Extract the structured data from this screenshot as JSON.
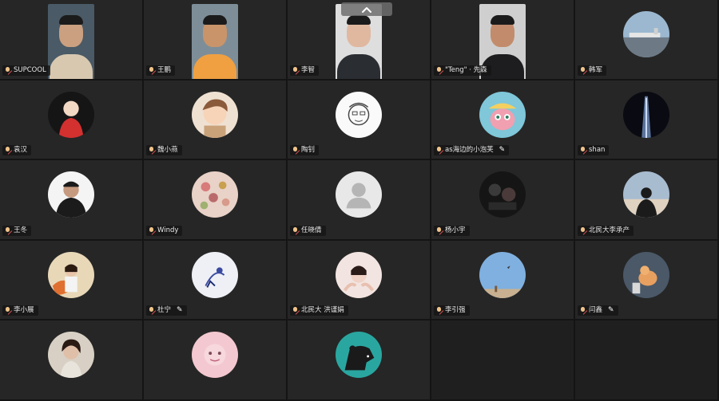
{
  "collapse_control": {
    "icon": "chevron-up-icon"
  },
  "participants": [
    {
      "name": "SUPCOOL",
      "kind": "video",
      "bg": "#4a5a66",
      "shirt": "#d8c8b0",
      "skin": "#caa080"
    },
    {
      "name": "王鹏",
      "kind": "video",
      "bg": "#7e8e99",
      "shirt": "#f0a040",
      "skin": "#c9946a"
    },
    {
      "name": "李智",
      "kind": "video",
      "bg": "#dedede",
      "shirt": "#2a2e33",
      "skin": "#e0b8a0"
    },
    {
      "name": "\"Teng\" · 先森",
      "kind": "video",
      "bg": "#cfcfcf",
      "shirt": "#1d1d1f",
      "skin": "#c28c6c"
    },
    {
      "name": "韩军",
      "kind": "avatar",
      "icon": "airport-photo-icon",
      "edit": false
    },
    {
      "name": "袁汉",
      "kind": "avatar",
      "icon": "red-shirt-figure-icon",
      "edit": false
    },
    {
      "name": "魏小燕",
      "kind": "avatar",
      "icon": "anime-boy-icon",
      "edit": false
    },
    {
      "name": "陶钊",
      "kind": "avatar",
      "icon": "sketch-face-icon",
      "edit": false
    },
    {
      "name": "as海边的小泡芙",
      "kind": "avatar",
      "icon": "cartoon-girl-icon",
      "edit": true
    },
    {
      "name": "shan",
      "kind": "avatar",
      "icon": "light-beam-icon",
      "edit": false
    },
    {
      "name": "王冬",
      "kind": "avatar",
      "icon": "man-black-jacket-icon",
      "edit": false
    },
    {
      "name": "Windy",
      "kind": "avatar",
      "icon": "flower-pattern-icon",
      "edit": false
    },
    {
      "name": "任晓倩",
      "kind": "avatar",
      "icon": "default-user-icon",
      "edit": false
    },
    {
      "name": "杨小宇",
      "kind": "avatar",
      "icon": "dark-photo-icon",
      "edit": false
    },
    {
      "name": "北民大李承产",
      "kind": "avatar",
      "icon": "sunset-silhouette-icon",
      "edit": false
    },
    {
      "name": "李小展",
      "kind": "avatar",
      "icon": "autumn-girl-icon",
      "edit": false
    },
    {
      "name": "杜宁",
      "kind": "avatar",
      "icon": "blue-sketch-icon",
      "edit": true
    },
    {
      "name": "北民大 洪谨娟",
      "kind": "avatar",
      "icon": "girl-hands-icon",
      "edit": false
    },
    {
      "name": "李引强",
      "kind": "avatar",
      "icon": "sky-photo-icon",
      "edit": false
    },
    {
      "name": "闫鑫",
      "kind": "avatar",
      "icon": "cat-photo-icon",
      "edit": true
    },
    {
      "name": "",
      "kind": "avatar",
      "icon": "portrait-woman-icon",
      "edit": false
    },
    {
      "name": "",
      "kind": "avatar",
      "icon": "pink-face-icon",
      "edit": false
    },
    {
      "name": "",
      "kind": "avatar",
      "icon": "black-bear-icon",
      "edit": false
    },
    {
      "name": "",
      "kind": "empty"
    },
    {
      "name": "",
      "kind": "empty"
    }
  ]
}
